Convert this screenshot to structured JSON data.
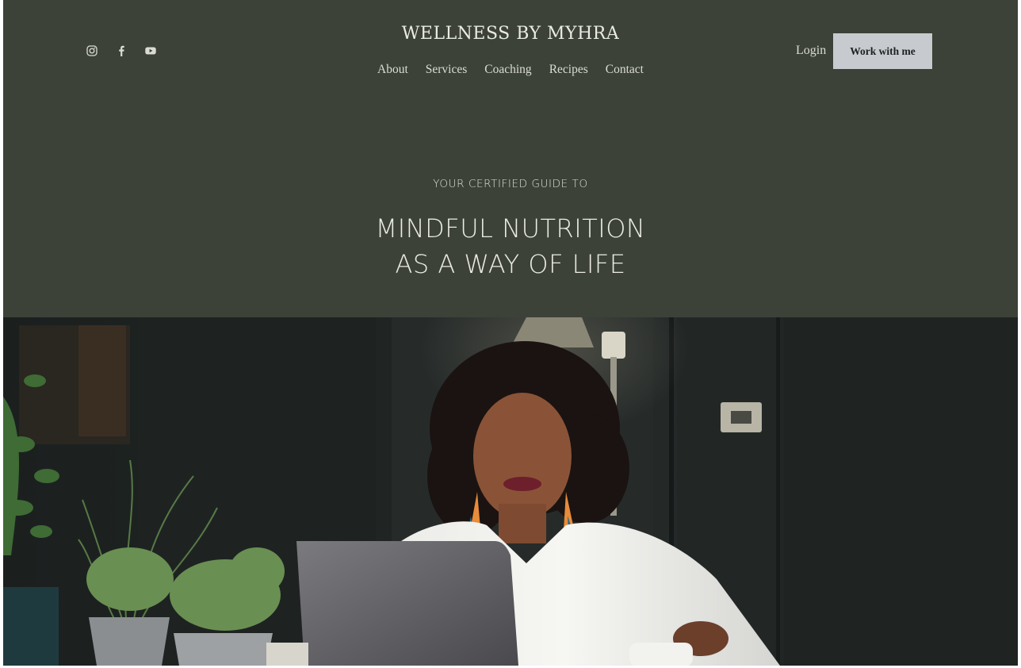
{
  "header": {
    "brand": "WELLNESS BY MYHRA",
    "socials": [
      {
        "icon": "instagram-icon"
      },
      {
        "icon": "facebook-icon"
      },
      {
        "icon": "youtube-icon"
      }
    ],
    "nav": [
      "About",
      "Services",
      "Coaching",
      "Recipes",
      "Contact"
    ],
    "login_label": "Login",
    "cta_label": "Work with me"
  },
  "hero": {
    "eyebrow": "YOUR CERTIFIED GUIDE TO",
    "headline_line1": "MINDFUL NUTRITION",
    "headline_line2": "AS A WAY OF LIFE"
  },
  "colors": {
    "background": "#3d4238",
    "cta_background": "#c7cbd0",
    "text_light": "#e9ebe4"
  }
}
